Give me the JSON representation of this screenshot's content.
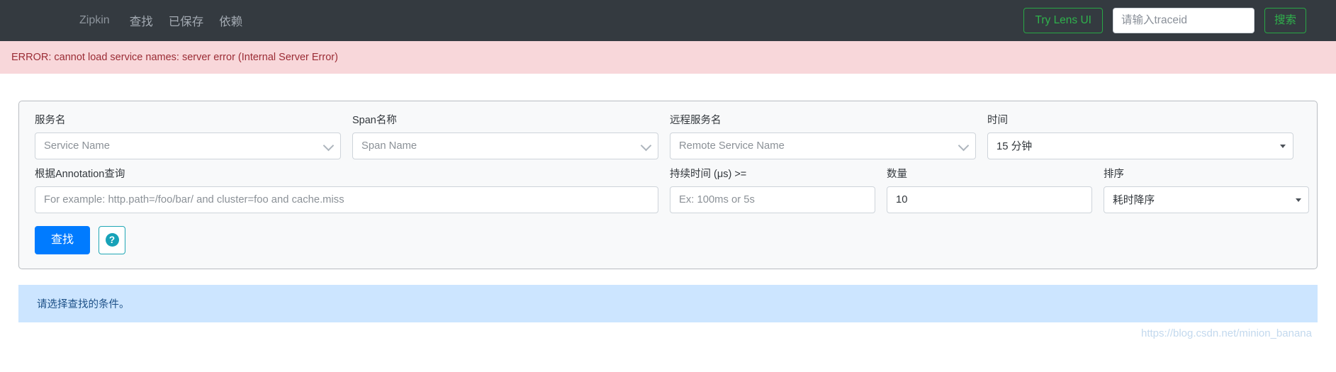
{
  "navbar": {
    "brand": "Zipkin",
    "links": [
      {
        "label": "查找",
        "name": "nav-link-find"
      },
      {
        "label": "已保存",
        "name": "nav-link-saved"
      },
      {
        "label": "依赖",
        "name": "nav-link-dependencies"
      }
    ],
    "lens_button": "Try Lens UI",
    "trace_placeholder": "请输入traceid",
    "trace_value": "",
    "search_button": "搜索"
  },
  "alerts": {
    "error": "ERROR: cannot load service names: server error (Internal Server Error)",
    "info": "请选择查找的条件。"
  },
  "form": {
    "service": {
      "label": "服务名",
      "placeholder": "Service Name"
    },
    "span": {
      "label": "Span名称",
      "placeholder": "Span Name"
    },
    "remote": {
      "label": "远程服务名",
      "placeholder": "Remote Service Name"
    },
    "time": {
      "label": "时间",
      "value": "15 分钟"
    },
    "annotation": {
      "label": "根据Annotation查询",
      "placeholder": "For example: http.path=/foo/bar/ and cluster=foo and cache.miss"
    },
    "duration": {
      "label": "持续时间 (μs) >=",
      "placeholder": "Ex: 100ms or 5s"
    },
    "count": {
      "label": "数量",
      "value": "10"
    },
    "sort": {
      "label": "排序",
      "value": "耗时降序"
    },
    "find_button": "查找",
    "help_glyph": "?"
  },
  "watermark": "https://blog.csdn.net/minion_banana",
  "colors": {
    "navbar_bg": "#343a40",
    "accent_green": "#28a745",
    "primary_blue": "#007bff",
    "error_bg": "#f8d7da",
    "info_bg": "#cce5ff",
    "help_teal": "#17a2b8"
  }
}
